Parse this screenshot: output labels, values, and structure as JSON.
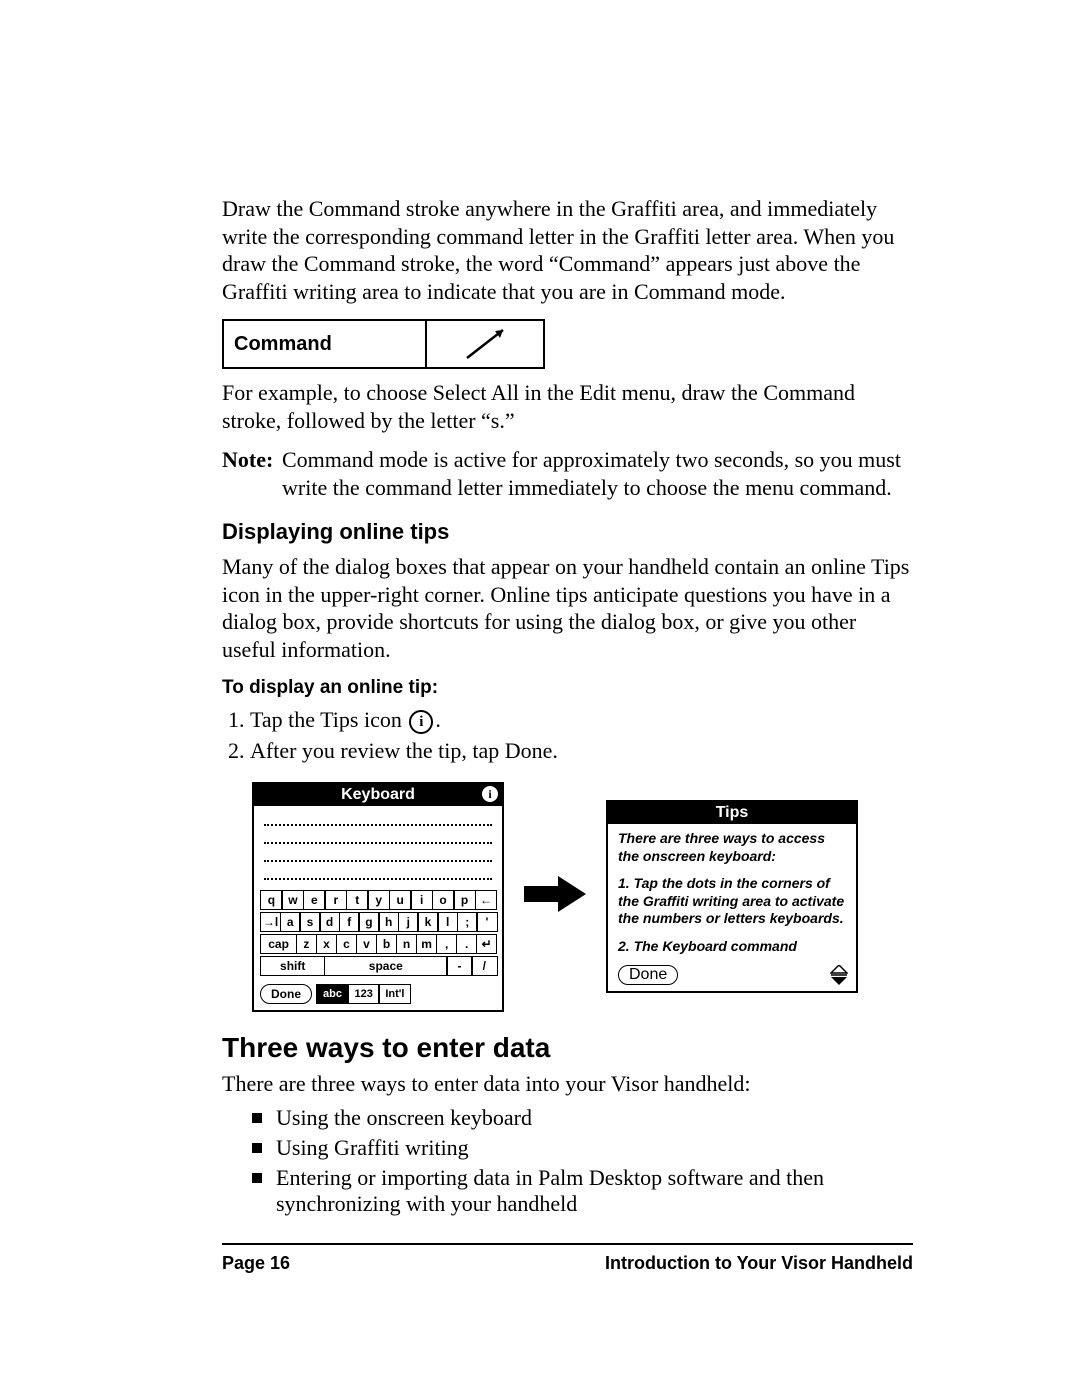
{
  "intro_paragraph": "Draw the Command stroke anywhere in the Graffiti area, and immediately write the corresponding command letter in the Graffiti letter area. When you draw the Command stroke, the word “Command” appears just above the Graffiti writing area to indicate that you are in Command mode.",
  "command_box_label": "Command",
  "example_paragraph": "For example, to choose Select All in the Edit menu, draw the Command stroke, followed by the letter “s.”",
  "note_label": "Note:",
  "note_text": "Command mode is active for approximately two seconds, so you must write the command letter immediately to choose the menu command.",
  "section_tips_heading": "Displaying online tips",
  "section_tips_paragraph": "Many of the dialog boxes that appear on your handheld contain an online Tips icon in the upper-right corner. Online tips anticipate questions you have in a dialog box, provide shortcuts for using the dialog box, or give you other useful information.",
  "section_tips_subheading": "To display an online tip:",
  "steps": [
    {
      "pre": "Tap the Tips icon ",
      "icon": "i",
      "post": "."
    },
    {
      "pre": "After you review the tip, tap Done.",
      "icon": null,
      "post": ""
    }
  ],
  "keyboard_panel": {
    "title": "Keyboard",
    "tips_glyph": "i",
    "rows": [
      [
        "q",
        "w",
        "e",
        "r",
        "t",
        "y",
        "u",
        "i",
        "o",
        "p",
        "←"
      ],
      [
        "→l",
        "a",
        "s",
        "d",
        "f",
        "g",
        "h",
        "j",
        "k",
        "l",
        ";",
        "'"
      ],
      [
        "cap",
        "z",
        "x",
        "c",
        "v",
        "b",
        "n",
        "m",
        ",",
        ".",
        "↵"
      ],
      [
        "shift",
        "space",
        "-",
        "/"
      ]
    ],
    "done_label": "Done",
    "modes": [
      "abc",
      "123",
      "Int'l"
    ],
    "active_mode": 0
  },
  "tips_panel": {
    "title": "Tips",
    "lines": [
      "There are three ways to access the onscreen keyboard:",
      "1. Tap the dots in the corners of the Graffiti writing area to activate the numbers or letters keyboards.",
      "2. The Keyboard command"
    ],
    "done_label": "Done"
  },
  "section_three_ways_heading": "Three ways to enter data",
  "section_three_ways_intro": "There are three ways to enter data into your Visor handheld:",
  "three_ways_items": [
    "Using the onscreen keyboard",
    "Using Graffiti writing",
    "Entering or importing data in Palm Desktop software and then synchronizing with your handheld"
  ],
  "footer_left": "Page 16",
  "footer_right": "Introduction to Your Visor Handheld"
}
